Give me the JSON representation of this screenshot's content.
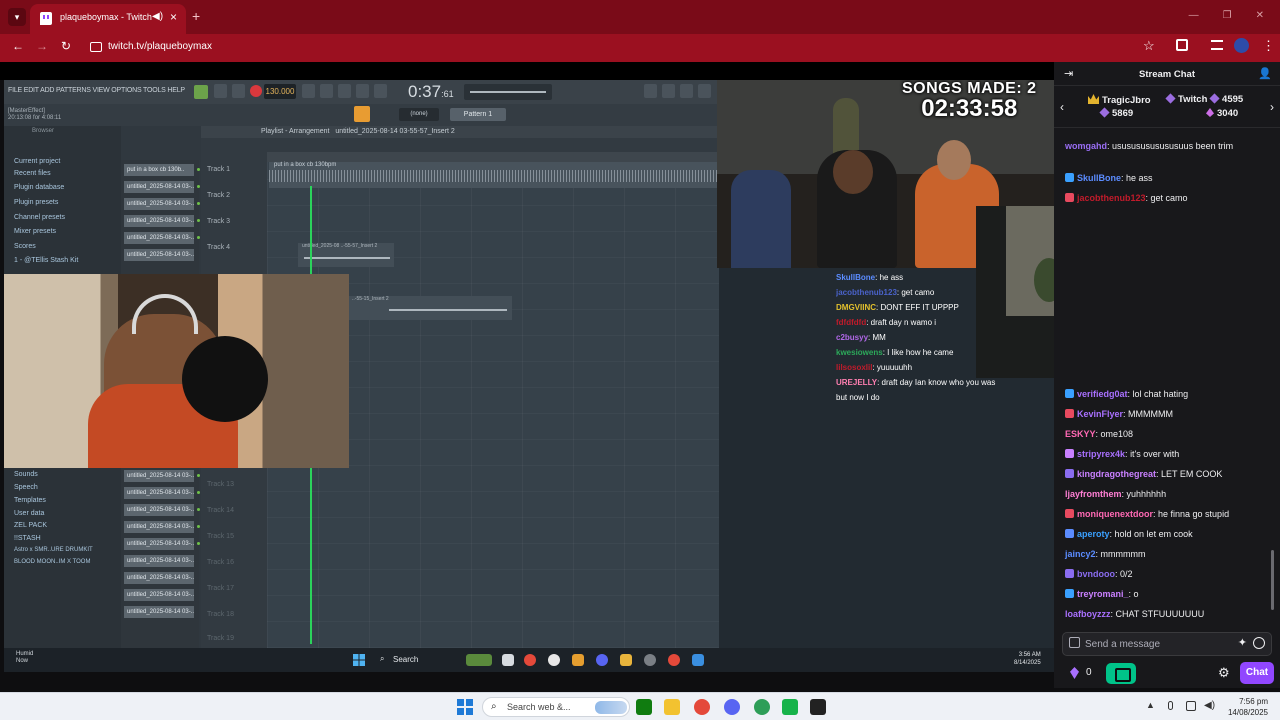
{
  "browser": {
    "tab_title": "plaqueboymax - Twitch",
    "url": "twitch.tv/plaqueboymax"
  },
  "fl_studio": {
    "menu": "FILE EDIT ADD PATTERNS VIEW OPTIONS TOOLS HELP",
    "tempo": "130.000",
    "time": "0:37",
    "time_small": ":61",
    "hint_lines": [
      "[MasterEffect]",
      "20:13:08 for 4:08:11"
    ],
    "pattern_label": "Pattern 1",
    "snap_label": "(none)",
    "browser_title": "Browser",
    "browser_items": [
      "Current project",
      "Recent files",
      "Plugin database",
      "Plugin presets",
      "Channel presets",
      "Mixer presets",
      "Scores",
      "1 - @TEllis Stash Kit"
    ],
    "browser_items_lower": [
      "Sounds",
      "Speech",
      "Templates",
      "User data",
      "ZEL PACK",
      "!!STASH",
      "Astro x SMR..URE DRUMKIT",
      "BLOOD MOON..IM X TOOM"
    ],
    "playlist_title": "Playlist - Arrangement",
    "playlist_crumb": "untitled_2025-08-14 03-55-57_Insert 2",
    "channel_first": "put in a box cb 130b..",
    "channel_name": "untitled_2025-08-14 03-..",
    "tracks": [
      "Track 1",
      "Track 2",
      "Track 3",
      "Track 4"
    ],
    "tracks_dim": [
      "Track 13",
      "Track 14",
      "Track 15",
      "Track 16",
      "Track 17",
      "Track 18",
      "Track 19"
    ],
    "clip_top_label": "put in a box cb 130bpm",
    "clip_2_label": "untitled_2025-08 ..-55-57_Insert 2",
    "clip_3_label": "..-55-15_Insert 2",
    "taskbar": {
      "weather_title": "Humid",
      "weather_sub": "Now",
      "search": "Search",
      "clock_time": "3:56 AM",
      "clock_date": "8/14/2025"
    }
  },
  "overlay": {
    "songs_label": "SONGS MADE: 2",
    "songs_timer": "02:33:58"
  },
  "stream_chat_overlay": [
    {
      "user": "SkullBone",
      "sep": ": ",
      "text": "he ass",
      "color": "#5b8cff"
    },
    {
      "user": "jacobthenub123",
      "sep": ": ",
      "text": "get camo",
      "color": "#4a62c9"
    },
    {
      "user": "DMGVIINC",
      "sep": ": ",
      "text": "DONT EFF IT UPPPP",
      "color": "#e3c12d"
    },
    {
      "user": "fdfdfdfd",
      "sep": ": ",
      "text": "draft day n wamo i",
      "color": "#c11b2b"
    },
    {
      "user": "c2busyy",
      "sep": ": ",
      "text": "MM",
      "color": "#b168e8"
    },
    {
      "user": "kwesiowens",
      "sep": ": ",
      "text": "I like how he came",
      "color": "#2ca95a"
    },
    {
      "user": "lilsosoxlil",
      "sep": ": ",
      "text": "yuuuuuhh",
      "color": "#c11b2b"
    },
    {
      "user": "UREJELLY",
      "sep": ": ",
      "text": "draft day Ian know who you was",
      "color": "#ff7fb1"
    },
    {
      "user": "",
      "sep": "",
      "text": "but now I do",
      "color": "#ffffff"
    }
  ],
  "chat": {
    "title": "Stream Chat",
    "leaderboard": [
      {
        "name": "TragicJbro",
        "amount": "5869"
      },
      {
        "name": "Twitch",
        "amount": "4595"
      },
      {
        "name": "",
        "amount": "3040"
      }
    ],
    "messages_top": [
      {
        "user": "womgahd",
        "text": "usususususususuus been trim",
        "color": "#9a6ef5"
      },
      {
        "user": "SkullBone",
        "text": "he ass",
        "color": "#5b8cff"
      },
      {
        "user": "jacobthenub123",
        "text": "get camo",
        "color": "#c11b2b"
      }
    ],
    "messages": [
      {
        "user": "verifiedg0at",
        "text": "lol chat hating",
        "color": "#a970ff"
      },
      {
        "user": "KevinFlyer",
        "text": "MMMMMM",
        "color": "#a970ff"
      },
      {
        "user": "ESKYY",
        "text": "ome108",
        "color": "#ff69b4"
      },
      {
        "user": "stripyrex4k",
        "text": "it's over with",
        "color": "#a970ff"
      },
      {
        "user": "kingdragothegreat",
        "text": "LET EM COOK",
        "color": "#c980ff"
      },
      {
        "user": "ljayfromthem",
        "text": "yuhhhhhh",
        "color": "#ff7fd4"
      },
      {
        "user": "moniquenextdoor",
        "text": "he finna go stupid",
        "color": "#ff69b4"
      },
      {
        "user": "aperoty",
        "text": "hold on let em cook",
        "color": "#3aa0ff"
      },
      {
        "user": "jaincy2",
        "text": "mmmmmm",
        "color": "#5b8cff"
      },
      {
        "user": "bvndooo",
        "text": "0/2",
        "color": "#8a6cf0"
      },
      {
        "user": "treyromani_",
        "text": "o",
        "color": "#c980ff"
      },
      {
        "user": "loafboyzzz",
        "text": "CHAT STFUUUUUUU",
        "color": "#a970ff"
      }
    ],
    "input_placeholder": "Send a message",
    "points": "0",
    "chat_button": "Chat"
  },
  "os_taskbar": {
    "search": "Search web &...",
    "time": "7:56 pm",
    "date": "14/08/2025"
  },
  "colors": {
    "tab_bar": "#7a0b18",
    "url_bar": "#9b1020",
    "twitch_purple": "#9147ff",
    "playhead": "#2bd35b"
  },
  "icons": [
    "chevron-down-icon",
    "twitch-icon",
    "speaker-icon",
    "close-icon",
    "plus-icon",
    "back-icon",
    "forward-icon",
    "reload-icon",
    "star-icon",
    "extension-icon",
    "cast-icon",
    "menu-icon",
    "collapse-icon",
    "users-icon",
    "settings-icon",
    "emote-icon",
    "bits-icon",
    "windows-icon",
    "search-icon"
  ]
}
